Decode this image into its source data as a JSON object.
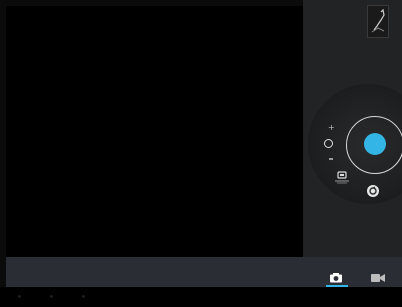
{
  "app": {
    "type": "camera"
  },
  "controls": {
    "shutter_color": "#33b5e5",
    "zoom": {
      "plus_label": "+",
      "minus_label": "-"
    }
  },
  "icons": {
    "thumbnail": "photo-thumbnail-icon",
    "settings": "camera-settings-icon",
    "switch_camera": "switch-camera-icon",
    "mode_camera": "camera-mode-icon",
    "mode_video": "video-mode-icon"
  },
  "modes": {
    "selected": "camera"
  },
  "colors": {
    "accent": "#33b5e5",
    "panel": "#222324",
    "mode_bar": "#2a2d33"
  }
}
